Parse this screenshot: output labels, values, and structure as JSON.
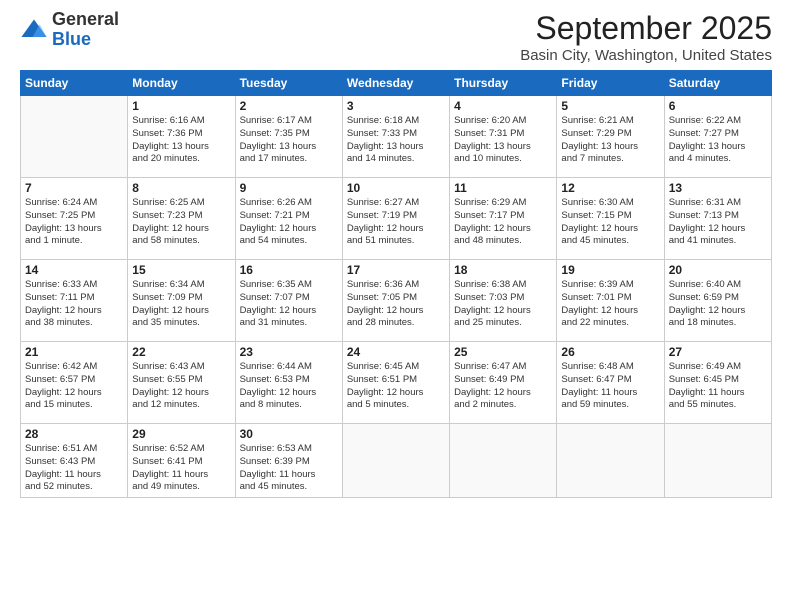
{
  "header": {
    "logo_general": "General",
    "logo_blue": "Blue",
    "title": "September 2025",
    "subtitle": "Basin City, Washington, United States"
  },
  "weekdays": [
    "Sunday",
    "Monday",
    "Tuesday",
    "Wednesday",
    "Thursday",
    "Friday",
    "Saturday"
  ],
  "weeks": [
    [
      {
        "day": "",
        "info": ""
      },
      {
        "day": "1",
        "info": "Sunrise: 6:16 AM\nSunset: 7:36 PM\nDaylight: 13 hours\nand 20 minutes."
      },
      {
        "day": "2",
        "info": "Sunrise: 6:17 AM\nSunset: 7:35 PM\nDaylight: 13 hours\nand 17 minutes."
      },
      {
        "day": "3",
        "info": "Sunrise: 6:18 AM\nSunset: 7:33 PM\nDaylight: 13 hours\nand 14 minutes."
      },
      {
        "day": "4",
        "info": "Sunrise: 6:20 AM\nSunset: 7:31 PM\nDaylight: 13 hours\nand 10 minutes."
      },
      {
        "day": "5",
        "info": "Sunrise: 6:21 AM\nSunset: 7:29 PM\nDaylight: 13 hours\nand 7 minutes."
      },
      {
        "day": "6",
        "info": "Sunrise: 6:22 AM\nSunset: 7:27 PM\nDaylight: 13 hours\nand 4 minutes."
      }
    ],
    [
      {
        "day": "7",
        "info": "Sunrise: 6:24 AM\nSunset: 7:25 PM\nDaylight: 13 hours\nand 1 minute."
      },
      {
        "day": "8",
        "info": "Sunrise: 6:25 AM\nSunset: 7:23 PM\nDaylight: 12 hours\nand 58 minutes."
      },
      {
        "day": "9",
        "info": "Sunrise: 6:26 AM\nSunset: 7:21 PM\nDaylight: 12 hours\nand 54 minutes."
      },
      {
        "day": "10",
        "info": "Sunrise: 6:27 AM\nSunset: 7:19 PM\nDaylight: 12 hours\nand 51 minutes."
      },
      {
        "day": "11",
        "info": "Sunrise: 6:29 AM\nSunset: 7:17 PM\nDaylight: 12 hours\nand 48 minutes."
      },
      {
        "day": "12",
        "info": "Sunrise: 6:30 AM\nSunset: 7:15 PM\nDaylight: 12 hours\nand 45 minutes."
      },
      {
        "day": "13",
        "info": "Sunrise: 6:31 AM\nSunset: 7:13 PM\nDaylight: 12 hours\nand 41 minutes."
      }
    ],
    [
      {
        "day": "14",
        "info": "Sunrise: 6:33 AM\nSunset: 7:11 PM\nDaylight: 12 hours\nand 38 minutes."
      },
      {
        "day": "15",
        "info": "Sunrise: 6:34 AM\nSunset: 7:09 PM\nDaylight: 12 hours\nand 35 minutes."
      },
      {
        "day": "16",
        "info": "Sunrise: 6:35 AM\nSunset: 7:07 PM\nDaylight: 12 hours\nand 31 minutes."
      },
      {
        "day": "17",
        "info": "Sunrise: 6:36 AM\nSunset: 7:05 PM\nDaylight: 12 hours\nand 28 minutes."
      },
      {
        "day": "18",
        "info": "Sunrise: 6:38 AM\nSunset: 7:03 PM\nDaylight: 12 hours\nand 25 minutes."
      },
      {
        "day": "19",
        "info": "Sunrise: 6:39 AM\nSunset: 7:01 PM\nDaylight: 12 hours\nand 22 minutes."
      },
      {
        "day": "20",
        "info": "Sunrise: 6:40 AM\nSunset: 6:59 PM\nDaylight: 12 hours\nand 18 minutes."
      }
    ],
    [
      {
        "day": "21",
        "info": "Sunrise: 6:42 AM\nSunset: 6:57 PM\nDaylight: 12 hours\nand 15 minutes."
      },
      {
        "day": "22",
        "info": "Sunrise: 6:43 AM\nSunset: 6:55 PM\nDaylight: 12 hours\nand 12 minutes."
      },
      {
        "day": "23",
        "info": "Sunrise: 6:44 AM\nSunset: 6:53 PM\nDaylight: 12 hours\nand 8 minutes."
      },
      {
        "day": "24",
        "info": "Sunrise: 6:45 AM\nSunset: 6:51 PM\nDaylight: 12 hours\nand 5 minutes."
      },
      {
        "day": "25",
        "info": "Sunrise: 6:47 AM\nSunset: 6:49 PM\nDaylight: 12 hours\nand 2 minutes."
      },
      {
        "day": "26",
        "info": "Sunrise: 6:48 AM\nSunset: 6:47 PM\nDaylight: 11 hours\nand 59 minutes."
      },
      {
        "day": "27",
        "info": "Sunrise: 6:49 AM\nSunset: 6:45 PM\nDaylight: 11 hours\nand 55 minutes."
      }
    ],
    [
      {
        "day": "28",
        "info": "Sunrise: 6:51 AM\nSunset: 6:43 PM\nDaylight: 11 hours\nand 52 minutes."
      },
      {
        "day": "29",
        "info": "Sunrise: 6:52 AM\nSunset: 6:41 PM\nDaylight: 11 hours\nand 49 minutes."
      },
      {
        "day": "30",
        "info": "Sunrise: 6:53 AM\nSunset: 6:39 PM\nDaylight: 11 hours\nand 45 minutes."
      },
      {
        "day": "",
        "info": ""
      },
      {
        "day": "",
        "info": ""
      },
      {
        "day": "",
        "info": ""
      },
      {
        "day": "",
        "info": ""
      }
    ]
  ]
}
